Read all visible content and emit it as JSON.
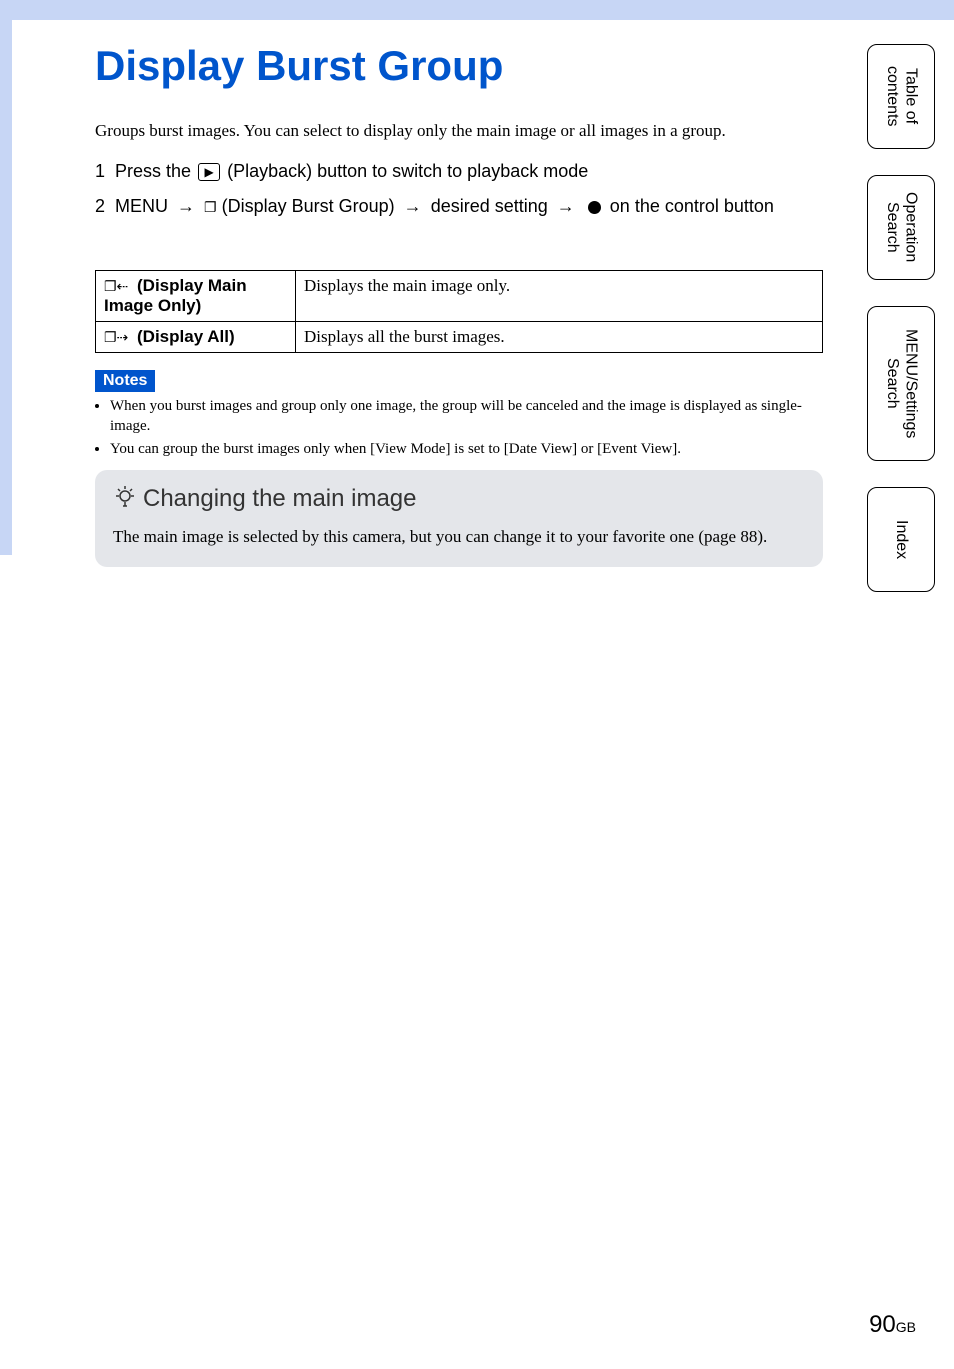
{
  "page": {
    "title": "Display Burst Group",
    "intro": "Groups burst images. You can select to display only the main image or all images in a group.",
    "page_number": "90",
    "page_suffix": "GB"
  },
  "steps": {
    "s1_num": "1",
    "s1_pre": "Press the ",
    "s1_post": " (Playback) button to switch to playback mode",
    "s2_num": "2",
    "s2_pre": "MENU ",
    "s2_mid1": " (Display Burst Group) ",
    "s2_mid2": " desired setting ",
    "s2_post": " on the control button"
  },
  "table": {
    "row1_label": "(Display Main Image Only)",
    "row1_desc": "Displays the main image only.",
    "row2_label": "(Display All)",
    "row2_desc": "Displays all the burst images."
  },
  "notes": {
    "label": "Notes",
    "n1": "When you burst images and group only one image, the group will be canceled and the image is displayed as single-image.",
    "n2": "You can group the burst images only when [View Mode] is set to [Date View] or [Event View]."
  },
  "tip": {
    "title": "Changing the main image",
    "text": "The main image is selected by this camera, but you can change it to your favorite one (page 88)."
  },
  "tabs": {
    "toc": "Table of contents",
    "op": "Operation Search",
    "menu": "MENU/Settings Search",
    "index": "Index"
  }
}
